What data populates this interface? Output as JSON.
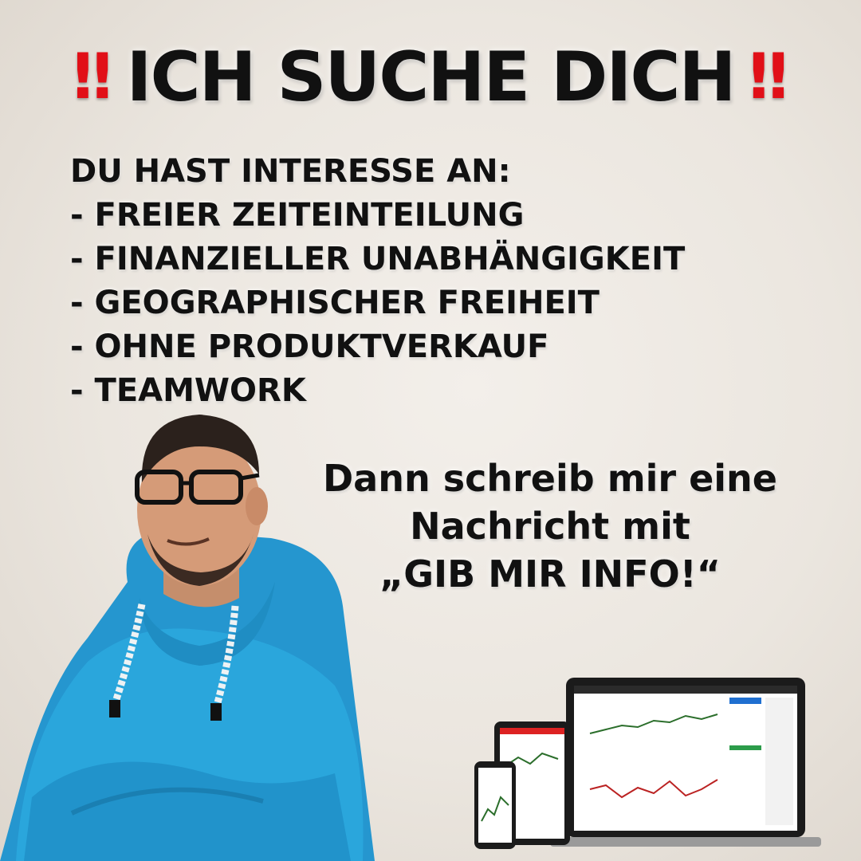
{
  "headline": {
    "left_mark": "‼",
    "title": "ICH SUCHE DICH",
    "right_mark": "‼",
    "mark_color": "#e10f17"
  },
  "interests": {
    "heading": "DU HAST INTERESSE AN:",
    "items": [
      "- FREIER ZEITEINTEILUNG",
      "- FINANZIELLER UNABHÄNGIGKEIT",
      "- GEOGRAPHISCHER FREIHEIT",
      "- OHNE PRODUKTVERKAUF",
      "- TEAMWORK"
    ]
  },
  "call_to_action": {
    "line1": "Dann schreib mir eine",
    "line2": "Nachricht mit",
    "line3": "„GIB MIR INFO!“"
  },
  "colors": {
    "hoodie": "#2aa6dc",
    "text": "#111111",
    "accent_red": "#e10f17"
  },
  "icons": [
    "double-exclamation-icon",
    "person-photo",
    "trading-devices-illustration"
  ]
}
